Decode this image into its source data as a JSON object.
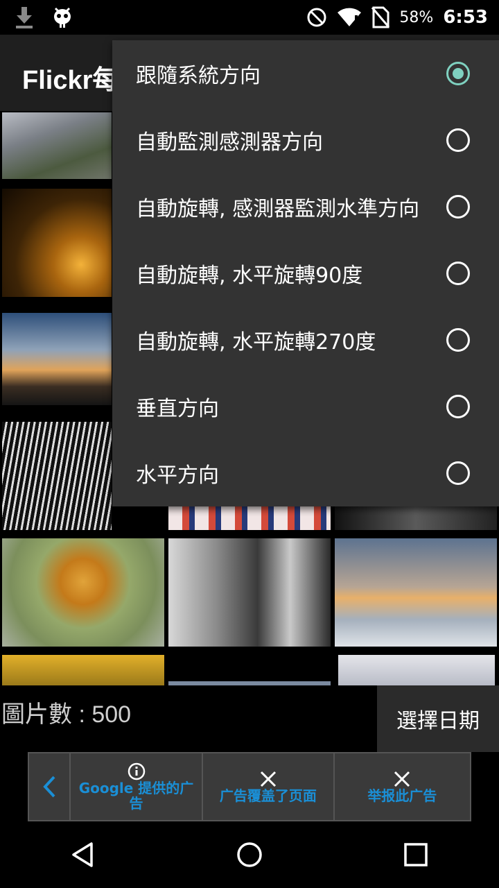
{
  "status_bar": {
    "battery": "58%",
    "time": "6:53"
  },
  "app_bar": {
    "title": "Flickr每"
  },
  "orientation_menu": {
    "options": [
      {
        "label": "跟隨系統方向",
        "selected": true
      },
      {
        "label": "自動監測感測器方向",
        "selected": false
      },
      {
        "label": "自動旋轉, 感測器監測水準方向",
        "selected": false
      },
      {
        "label": "自動旋轉, 水平旋轉90度",
        "selected": false
      },
      {
        "label": "自動旋轉, 水平旋轉270度",
        "selected": false
      },
      {
        "label": "垂直方向",
        "selected": false
      },
      {
        "label": "水平方向",
        "selected": false
      }
    ],
    "accent_color": "#7fd1c0"
  },
  "info_row": {
    "count_label": "圖片數 : 500",
    "date_button": "選擇日期"
  },
  "ad_bar": {
    "back_icon": "chevron-left-icon",
    "provider_label": "Google 提供的广告",
    "cover_label": "广告覆盖了页面",
    "report_label": "举报此广告",
    "link_color": "#1a8fd6"
  },
  "navigation": {
    "icons": [
      "back-icon",
      "home-icon",
      "recents-icon"
    ]
  }
}
